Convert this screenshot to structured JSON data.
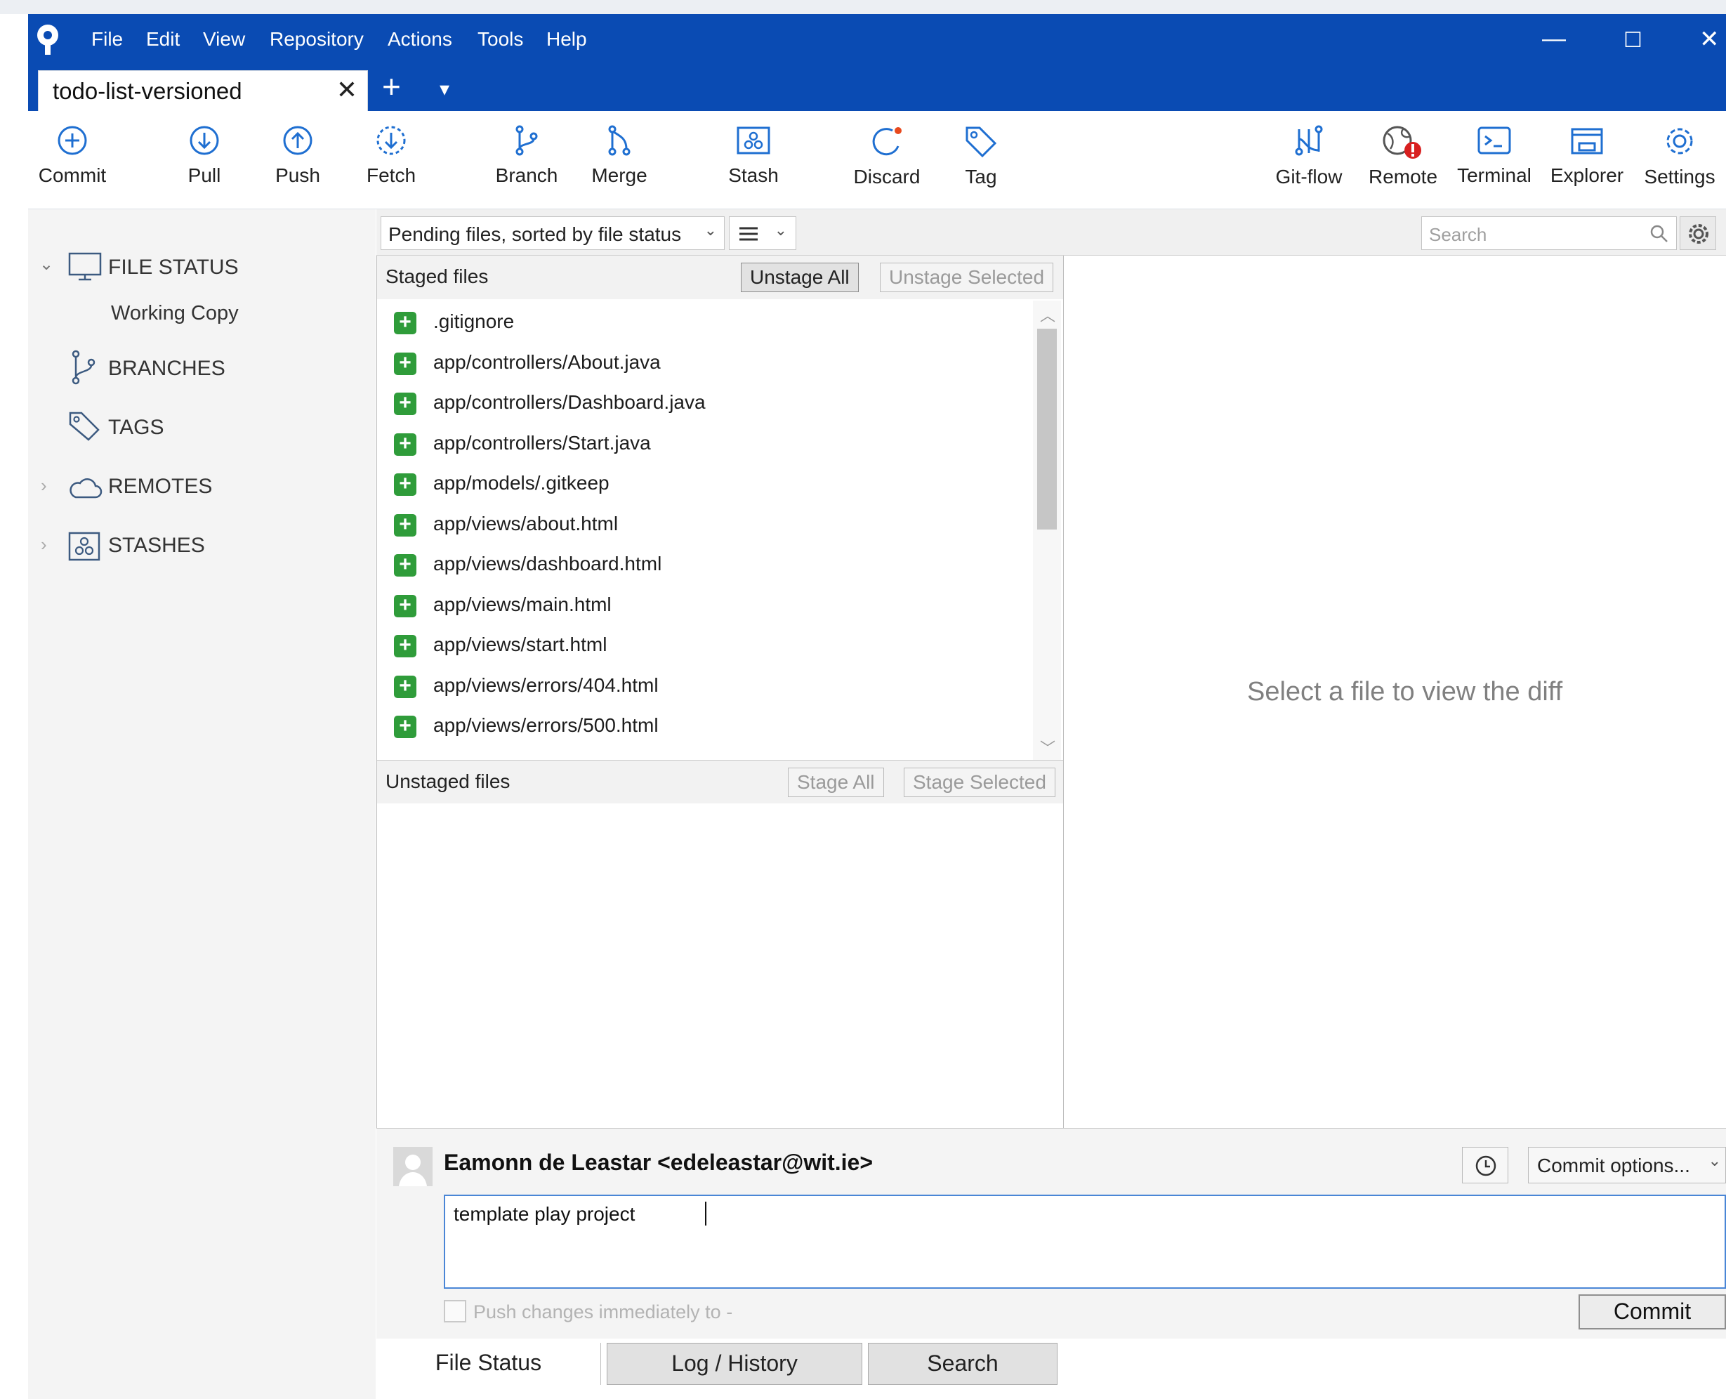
{
  "menu": [
    "File",
    "Edit",
    "View",
    "Repository",
    "Actions",
    "Tools",
    "Help"
  ],
  "window_controls": {
    "minimize": "—",
    "maximize": "☐",
    "close": "✕"
  },
  "tab": {
    "title": "todo-list-versioned",
    "close": "✕",
    "add": "+",
    "dropdown": "▾"
  },
  "toolbar": {
    "commit": "Commit",
    "pull": "Pull",
    "push": "Push",
    "fetch": "Fetch",
    "branch": "Branch",
    "merge": "Merge",
    "stash": "Stash",
    "discard": "Discard",
    "tag": "Tag",
    "gitflow": "Git-flow",
    "remote": "Remote",
    "terminal": "Terminal",
    "explorer": "Explorer",
    "settings": "Settings"
  },
  "sidebar": {
    "file_status": "FILE STATUS",
    "working_copy": "Working Copy",
    "branches": "BRANCHES",
    "tags": "TAGS",
    "remotes": "REMOTES",
    "stashes": "STASHES"
  },
  "filter": {
    "sort_label": "Pending files, sorted by file status",
    "search_placeholder": "Search"
  },
  "staged": {
    "title": "Staged files",
    "unstage_all": "Unstage All",
    "unstage_selected": "Unstage Selected",
    "files": [
      ".gitignore",
      "app/controllers/About.java",
      "app/controllers/Dashboard.java",
      "app/controllers/Start.java",
      "app/models/.gitkeep",
      "app/views/about.html",
      "app/views/dashboard.html",
      "app/views/main.html",
      "app/views/start.html",
      "app/views/errors/404.html",
      "app/views/errors/500.html"
    ]
  },
  "unstaged": {
    "title": "Unstaged files",
    "stage_all": "Stage All",
    "stage_selected": "Stage Selected"
  },
  "diff": {
    "message": "Select a file to view the diff"
  },
  "commit": {
    "author": "Eamonn de Leastar <edeleastar@wit.ie>",
    "options": "Commit options...",
    "message": "template play project",
    "push_label": "Push changes immediately to -",
    "button": "Commit"
  },
  "bottom_tabs": [
    "File Status",
    "Log / History",
    "Search"
  ]
}
